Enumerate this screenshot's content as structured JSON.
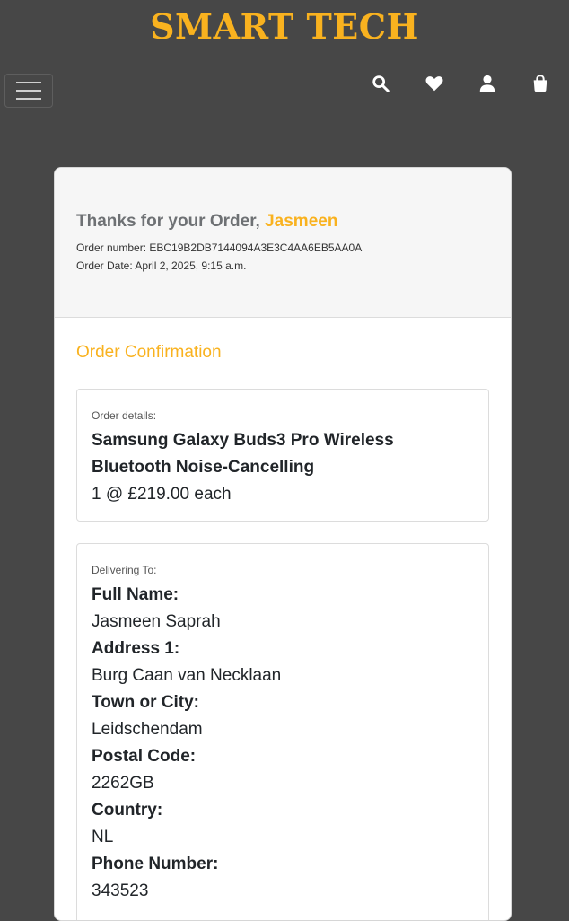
{
  "header": {
    "brand": "SMART TECH",
    "icons": [
      "search-icon",
      "heart-icon",
      "user-icon",
      "shopping-bag-icon"
    ],
    "accent_color": "#f9b21f"
  },
  "confirmation": {
    "thanks_prefix": "Thanks for your Order,",
    "customer_name": "Jasmeen",
    "order_number": "Order number: EBC19B2DB7144094A3E3C4AA6EB5AA0A",
    "order_date": "Order Date: April 2, 2025, 9:15 a.m.",
    "section_title": "Order Confirmation"
  },
  "order_details": {
    "label": "Order details:",
    "product_name": "Samsung Galaxy Buds3 Pro Wireless Bluetooth Noise-Cancelling",
    "quantity_price": "1 @ £219.00 each"
  },
  "delivery": {
    "label": "Delivering To:",
    "fields": [
      {
        "label": "Full Name:",
        "value": "Jasmeen Saprah"
      },
      {
        "label": "Address 1:",
        "value": "Burg Caan van Necklaan"
      },
      {
        "label": "Town or City:",
        "value": "Leidschendam"
      },
      {
        "label": "Postal Code:",
        "value": "2262GB"
      },
      {
        "label": "Country:",
        "value": "NL"
      },
      {
        "label": "Phone Number:",
        "value": "343523"
      }
    ]
  }
}
